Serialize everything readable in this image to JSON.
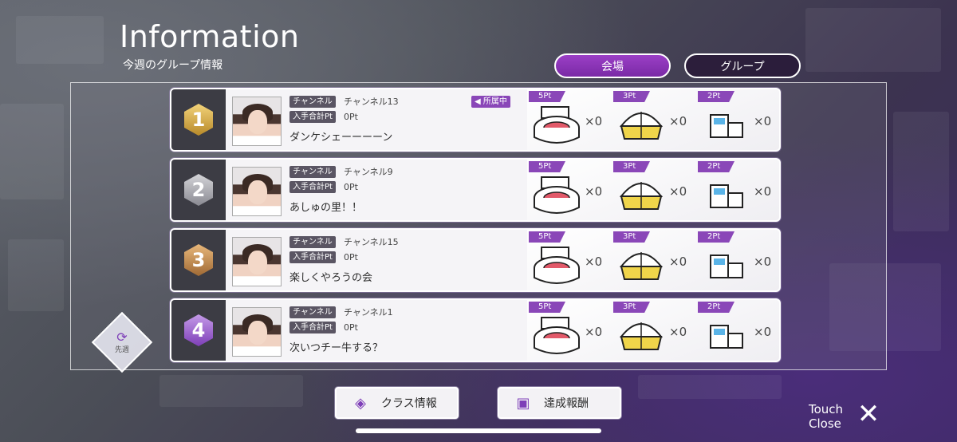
{
  "header": {
    "title": "Information",
    "subtitle": "今週のグループ情報"
  },
  "tabs": [
    {
      "label": "会場",
      "active": true
    },
    {
      "label": "グループ",
      "active": false
    }
  ],
  "labels": {
    "channel": "チャンネル",
    "points_total": "入手合計Pt",
    "belong": "◀ 所属中"
  },
  "venue_points": [
    "5Pt",
    "3Pt",
    "2Pt"
  ],
  "groups": [
    {
      "rank": "1",
      "channel": "チャンネル13",
      "points": "0Pt",
      "name": "ダンケシェーーーーン",
      "belong": true,
      "counts": [
        "×0",
        "×0",
        "×0"
      ]
    },
    {
      "rank": "2",
      "channel": "チャンネル9",
      "points": "0Pt",
      "name": "あしゅの里！！",
      "belong": false,
      "counts": [
        "×0",
        "×0",
        "×0"
      ]
    },
    {
      "rank": "3",
      "channel": "チャンネル15",
      "points": "0Pt",
      "name": "楽しくやろうの会",
      "belong": false,
      "counts": [
        "×0",
        "×0",
        "×0"
      ]
    },
    {
      "rank": "4",
      "channel": "チャンネル1",
      "points": "0Pt",
      "name": "次いつチー牛する？",
      "belong": false,
      "counts": [
        "×0",
        "×0",
        "×0"
      ]
    }
  ],
  "prev_week": "先週",
  "buttons": {
    "class_info": "クラス情報",
    "reward": "達成報酬"
  },
  "close": {
    "line1": "Touch",
    "line2": "Close"
  },
  "colors": {
    "accent": "#8a47b8",
    "tab_active": "#9b3fc6"
  }
}
